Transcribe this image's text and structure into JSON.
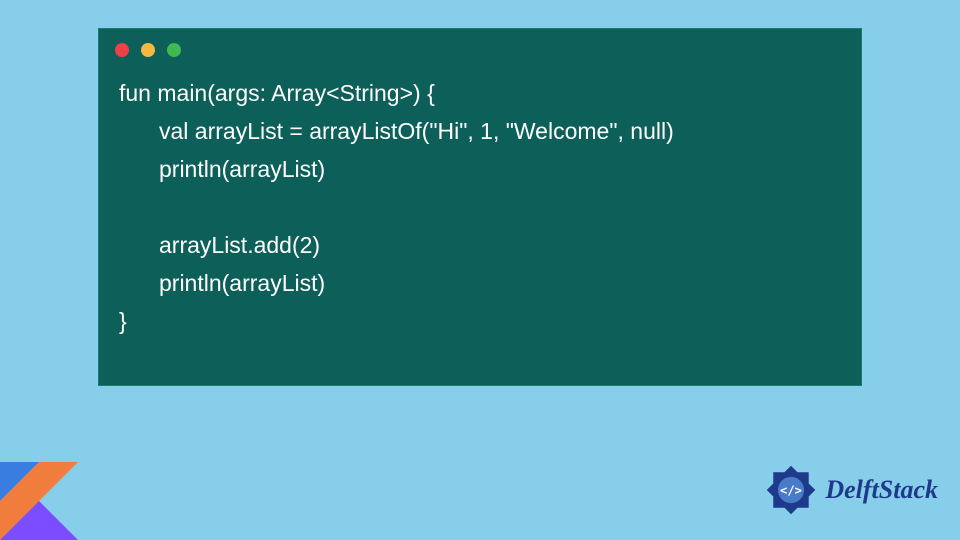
{
  "code": {
    "line1": "fun main(args: Array<String>) {",
    "line2": "val arrayList = arrayListOf(\"Hi\", 1, \"Welcome\", null)",
    "line3": "println(arrayList)",
    "line4": "",
    "line5": "arrayList.add(2)",
    "line6": "println(arrayList)",
    "line7": "}"
  },
  "brand": {
    "name": "DelftStack"
  },
  "colors": {
    "background": "#87ceeb",
    "window": "#0d5f5a",
    "text": "#ffffff",
    "brand_text": "#1e3a8a"
  }
}
